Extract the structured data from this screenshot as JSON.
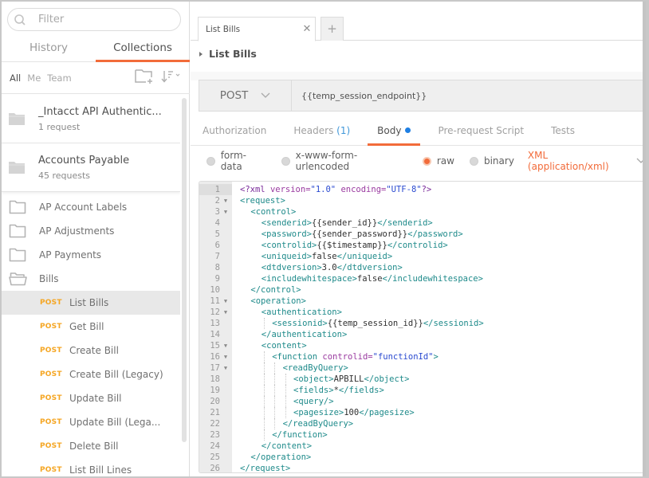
{
  "sidebar": {
    "filter_placeholder": "Filter",
    "tabs": [
      {
        "label": "History",
        "active": false
      },
      {
        "label": "Collections",
        "active": true
      }
    ],
    "owner_filters": [
      {
        "label": "All",
        "active": true
      },
      {
        "label": "Me",
        "active": false
      },
      {
        "label": "Team",
        "active": false
      }
    ],
    "icons": {
      "new_collection": "folder-plus-icon",
      "sort": "sort-icon"
    },
    "collections": [
      {
        "name": "_Intacct API Authentic...",
        "count": "1 request"
      },
      {
        "name": "Accounts Payable",
        "count": "45 requests"
      }
    ],
    "folders": [
      {
        "label": "AP Account Labels",
        "open": false
      },
      {
        "label": "AP Adjustments",
        "open": false
      },
      {
        "label": "AP Payments",
        "open": false
      },
      {
        "label": "Bills",
        "open": true
      }
    ],
    "requests": [
      {
        "method": "POST",
        "label": "List Bills",
        "selected": true
      },
      {
        "method": "POST",
        "label": "Get Bill",
        "selected": false
      },
      {
        "method": "POST",
        "label": "Create Bill",
        "selected": false
      },
      {
        "method": "POST",
        "label": "Create Bill (Legacy)",
        "selected": false
      },
      {
        "method": "POST",
        "label": "Update Bill",
        "selected": false
      },
      {
        "method": "POST",
        "label": "Update Bill (Lega...",
        "selected": false
      },
      {
        "method": "POST",
        "label": "Delete Bill",
        "selected": false
      },
      {
        "method": "POST",
        "label": "List Bill Lines",
        "selected": false
      }
    ]
  },
  "tabs": {
    "open": [
      {
        "label": "List Bills"
      }
    ],
    "close_symbol": "✕",
    "add_symbol": "+"
  },
  "request": {
    "name": "List Bills",
    "method": "POST",
    "url": "{{temp_session_endpoint}}",
    "tabs": [
      {
        "label": "Authorization",
        "count": "",
        "active": false
      },
      {
        "label": "Headers",
        "count": "(1)",
        "active": false
      },
      {
        "label": "Body",
        "count": "",
        "active": true,
        "dot": true
      },
      {
        "label": "Pre-request Script",
        "count": "",
        "active": false
      },
      {
        "label": "Tests",
        "count": "",
        "active": false
      }
    ],
    "body_modes": [
      {
        "label": "form-data",
        "selected": false
      },
      {
        "label": "x-www-form-urlencoded",
        "selected": false
      },
      {
        "label": "raw",
        "selected": true
      },
      {
        "label": "binary",
        "selected": false
      }
    ],
    "content_type": "XML (application/xml)"
  },
  "colors": {
    "accent": "#f26b3a",
    "post_method": "#f5a623",
    "count_blue": "#3f97d9",
    "dot_blue": "#1e7fe3"
  },
  "editor": {
    "lines": [
      {
        "n": "1",
        "fold": false,
        "indent": 0,
        "segs": [
          [
            "pi",
            "<?xml "
          ],
          [
            "attr",
            "version="
          ],
          [
            "str",
            "\"1.0\""
          ],
          [
            "attr",
            " encoding="
          ],
          [
            "str",
            "\"UTF-8\""
          ],
          [
            "pi",
            "?>"
          ]
        ]
      },
      {
        "n": "2",
        "fold": true,
        "indent": 0,
        "segs": [
          [
            "tag",
            "<request>"
          ]
        ]
      },
      {
        "n": "3",
        "fold": true,
        "indent": 1,
        "segs": [
          [
            "tag",
            "<control>"
          ]
        ]
      },
      {
        "n": "4",
        "fold": false,
        "indent": 2,
        "segs": [
          [
            "tag",
            "<senderid>"
          ],
          [
            "txt",
            "{{sender_id}}"
          ],
          [
            "tag",
            "</senderid>"
          ]
        ]
      },
      {
        "n": "5",
        "fold": false,
        "indent": 2,
        "segs": [
          [
            "tag",
            "<password>"
          ],
          [
            "txt",
            "{{sender_password}}"
          ],
          [
            "tag",
            "</password>"
          ]
        ]
      },
      {
        "n": "6",
        "fold": false,
        "indent": 2,
        "segs": [
          [
            "tag",
            "<controlid>"
          ],
          [
            "txt",
            "{{$timestamp}}"
          ],
          [
            "tag",
            "</controlid>"
          ]
        ]
      },
      {
        "n": "7",
        "fold": false,
        "indent": 2,
        "segs": [
          [
            "tag",
            "<uniqueid>"
          ],
          [
            "txt",
            "false"
          ],
          [
            "tag",
            "</uniqueid>"
          ]
        ]
      },
      {
        "n": "8",
        "fold": false,
        "indent": 2,
        "segs": [
          [
            "tag",
            "<dtdversion>"
          ],
          [
            "txt",
            "3.0"
          ],
          [
            "tag",
            "</dtdversion>"
          ]
        ]
      },
      {
        "n": "9",
        "fold": false,
        "indent": 2,
        "segs": [
          [
            "tag",
            "<includewhitespace>"
          ],
          [
            "txt",
            "false"
          ],
          [
            "tag",
            "</includewhitespace>"
          ]
        ]
      },
      {
        "n": "10",
        "fold": false,
        "indent": 1,
        "segs": [
          [
            "tag",
            "</control>"
          ]
        ]
      },
      {
        "n": "11",
        "fold": true,
        "indent": 1,
        "segs": [
          [
            "tag",
            "<operation>"
          ]
        ]
      },
      {
        "n": "12",
        "fold": true,
        "indent": 2,
        "segs": [
          [
            "tag",
            "<authentication>"
          ]
        ]
      },
      {
        "n": "13",
        "fold": false,
        "indent": 3,
        "segs": [
          [
            "tag",
            "<sessionid>"
          ],
          [
            "txt",
            "{{temp_session_id}}"
          ],
          [
            "tag",
            "</sessionid>"
          ]
        ]
      },
      {
        "n": "14",
        "fold": false,
        "indent": 2,
        "segs": [
          [
            "tag",
            "</authentication>"
          ]
        ]
      },
      {
        "n": "15",
        "fold": true,
        "indent": 2,
        "segs": [
          [
            "tag",
            "<content>"
          ]
        ]
      },
      {
        "n": "16",
        "fold": true,
        "indent": 3,
        "segs": [
          [
            "tag",
            "<function "
          ],
          [
            "attr",
            "controlid="
          ],
          [
            "str",
            "\"functionId\""
          ],
          [
            "tag",
            ">"
          ]
        ]
      },
      {
        "n": "17",
        "fold": true,
        "indent": 4,
        "segs": [
          [
            "tag",
            "<readByQuery>"
          ]
        ]
      },
      {
        "n": "18",
        "fold": false,
        "indent": 5,
        "segs": [
          [
            "tag",
            "<object>"
          ],
          [
            "txt",
            "APBILL"
          ],
          [
            "tag",
            "</object>"
          ]
        ]
      },
      {
        "n": "19",
        "fold": false,
        "indent": 5,
        "segs": [
          [
            "tag",
            "<fields>"
          ],
          [
            "txt",
            "*"
          ],
          [
            "tag",
            "</fields>"
          ]
        ]
      },
      {
        "n": "20",
        "fold": false,
        "indent": 5,
        "segs": [
          [
            "tag",
            "<query/>"
          ]
        ]
      },
      {
        "n": "21",
        "fold": false,
        "indent": 5,
        "segs": [
          [
            "tag",
            "<pagesize>"
          ],
          [
            "txt",
            "100"
          ],
          [
            "tag",
            "</pagesize>"
          ]
        ]
      },
      {
        "n": "22",
        "fold": false,
        "indent": 4,
        "segs": [
          [
            "tag",
            "</readByQuery>"
          ]
        ]
      },
      {
        "n": "23",
        "fold": false,
        "indent": 3,
        "segs": [
          [
            "tag",
            "</function>"
          ]
        ]
      },
      {
        "n": "24",
        "fold": false,
        "indent": 2,
        "segs": [
          [
            "tag",
            "</content>"
          ]
        ]
      },
      {
        "n": "25",
        "fold": false,
        "indent": 1,
        "segs": [
          [
            "tag",
            "</operation>"
          ]
        ]
      },
      {
        "n": "26",
        "fold": false,
        "indent": 0,
        "segs": [
          [
            "tag",
            "</request>"
          ]
        ]
      }
    ],
    "active_line": "1"
  }
}
